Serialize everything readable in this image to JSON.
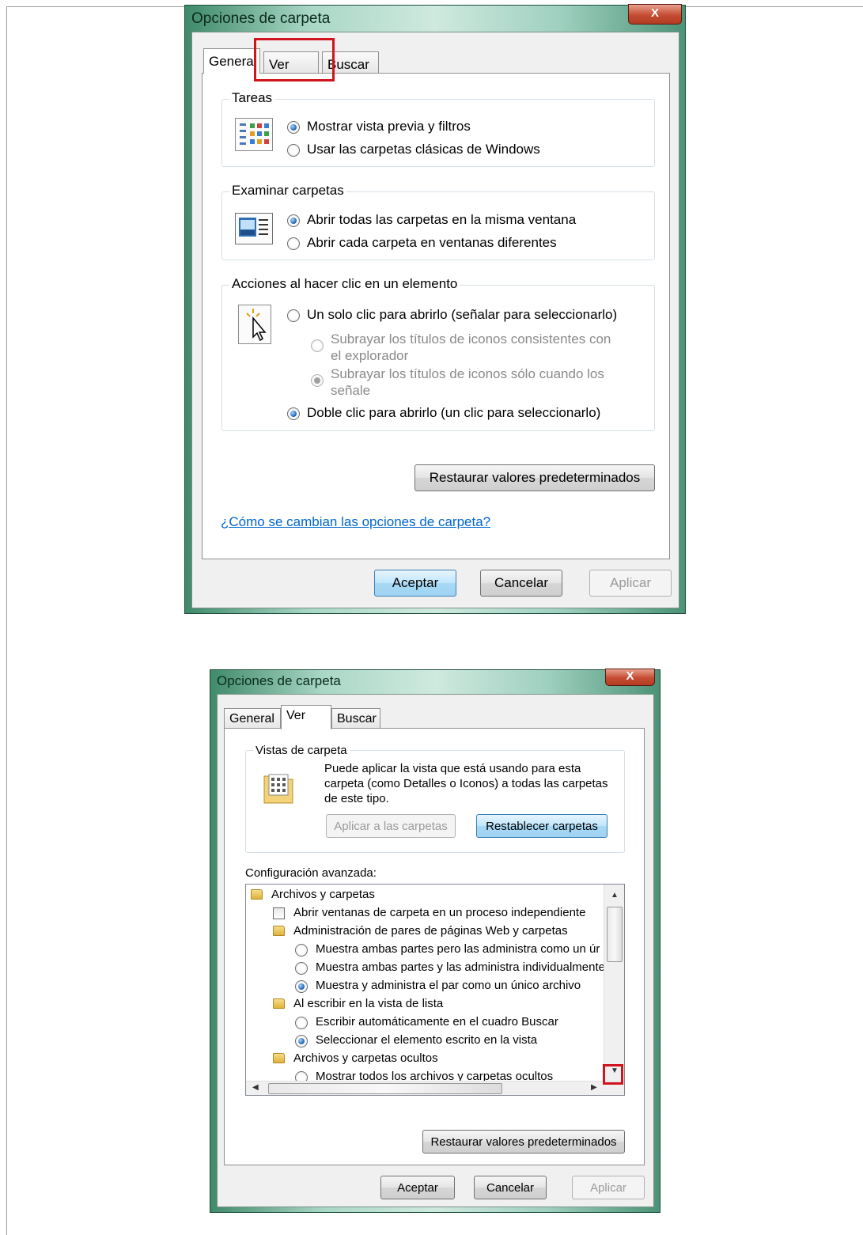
{
  "window1": {
    "title": "Opciones de carpeta",
    "close": "X",
    "tabs": [
      "General",
      "Ver",
      "Buscar"
    ],
    "tareas": {
      "label": "Tareas",
      "options": [
        "Mostrar vista previa y filtros",
        "Usar las carpetas clásicas de Windows"
      ],
      "selected": 0
    },
    "examinar": {
      "label": "Examinar carpetas",
      "options": [
        "Abrir todas las carpetas en la misma ventana",
        "Abrir cada carpeta en ventanas diferentes"
      ],
      "selected": 0
    },
    "acciones": {
      "label": "Acciones al hacer clic en un elemento",
      "single_click": "Un solo clic para abrirlo (señalar para seleccionarlo)",
      "sub1_line1": "Subrayar los títulos de iconos consistentes con",
      "sub1_line2": "el explorador",
      "sub2_line1": "Subrayar los títulos de iconos sólo cuando los",
      "sub2_line2": "señale",
      "double_click": "Doble clic para abrirlo (un clic para seleccionarlo)"
    },
    "restore_button": "Restaurar valores predeterminados",
    "help_link": "¿Cómo se cambian las opciones de carpeta?",
    "ok": "Aceptar",
    "cancel": "Cancelar",
    "apply": "Aplicar"
  },
  "window2": {
    "title": "Opciones de carpeta",
    "close": "X",
    "tabs": [
      "General",
      "Ver",
      "Buscar"
    ],
    "vistas": {
      "label": "Vistas de carpeta",
      "desc_line1": "Puede aplicar la vista que está usando para esta",
      "desc_line2": "carpeta (como Detalles o Iconos) a todas las carpetas",
      "desc_line3": "de este tipo.",
      "apply_button": "Aplicar a las carpetas",
      "reset_button": "Restablecer carpetas"
    },
    "advanced_label": "Configuración avanzada:",
    "tree": [
      {
        "kind": "folder",
        "text": "Archivos y carpetas"
      },
      {
        "kind": "check",
        "text": "Abrir ventanas de carpeta  en un proceso independiente"
      },
      {
        "kind": "folder",
        "text": "Administración de pares de páginas Web y carpetas"
      },
      {
        "kind": "radio",
        "text": "Muestra ambas partes pero las administra como un úr"
      },
      {
        "kind": "radio",
        "text": "Muestra ambas partes y las administra individualmente"
      },
      {
        "kind": "radio-on",
        "text": "Muestra y administra el par como un único archivo"
      },
      {
        "kind": "folder",
        "text": "Al escribir en la vista de lista"
      },
      {
        "kind": "radio",
        "text": "Escribir automáticamente en el cuadro Buscar"
      },
      {
        "kind": "radio-on",
        "text": "Seleccionar el elemento escrito en la vista"
      },
      {
        "kind": "folder",
        "text": "Archivos y carpetas ocultos"
      },
      {
        "kind": "radio",
        "text": "Mostrar todos los archivos y carpetas ocultos"
      }
    ],
    "restore_button": "Restaurar valores predeterminados",
    "ok": "Aceptar",
    "cancel": "Cancelar",
    "apply": "Aplicar"
  }
}
